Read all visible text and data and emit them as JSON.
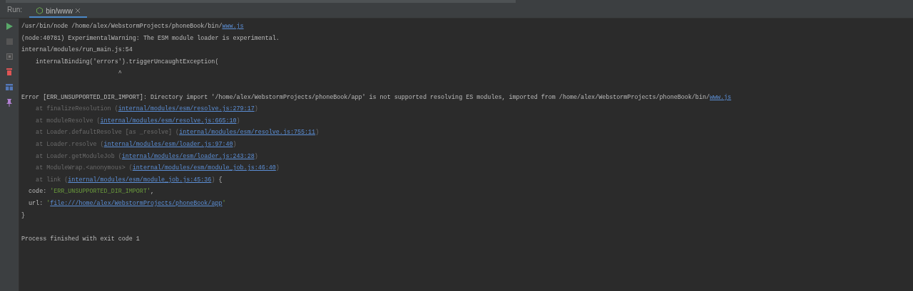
{
  "run_bar": {
    "label": "Run:",
    "tab": {
      "label": "bin/www",
      "selected": true
    }
  },
  "toolbar": [
    {
      "kind": "play"
    },
    {
      "kind": "stop"
    },
    {
      "kind": "restore"
    },
    {
      "kind": "trash"
    },
    {
      "kind": "layout"
    },
    {
      "kind": "pin"
    }
  ],
  "console": {
    "lines": [
      {
        "kind": "text",
        "segments": [
          {
            "kind": "plain",
            "text": "/usr/bin/node /home/alex/WebstormProjects/phoneBook/bin/"
          },
          {
            "kind": "link",
            "text": "www.js"
          }
        ]
      },
      {
        "kind": "text",
        "segments": [
          {
            "kind": "plain",
            "text": "(node:40781) ExperimentalWarning: The ESM module loader is experimental."
          }
        ]
      },
      {
        "kind": "text",
        "segments": [
          {
            "kind": "plain",
            "text": "internal/modules/run_main.js:54"
          }
        ]
      },
      {
        "kind": "text",
        "segments": [
          {
            "kind": "plain",
            "text": "    internalBinding('errors').triggerUncaughtException("
          }
        ]
      },
      {
        "kind": "text",
        "segments": [
          {
            "kind": "plain",
            "text": "                           ^"
          }
        ]
      },
      {
        "kind": "blank"
      },
      {
        "kind": "text",
        "segments": [
          {
            "kind": "plain",
            "text": "Error [ERR_UNSUPPORTED_DIR_IMPORT]: Directory import '/home/alex/WebstormProjects/phoneBook/app' is not supported resolving ES modules, imported from /home/alex/WebstormProjects/phoneBook/bin/"
          },
          {
            "kind": "link",
            "text": "www.js"
          }
        ]
      },
      {
        "kind": "text",
        "segments": [
          {
            "kind": "dim",
            "text": "    at finalizeResolution ("
          },
          {
            "kind": "link",
            "text": "internal/modules/esm/resolve.js:279:17"
          },
          {
            "kind": "dim",
            "text": ")"
          }
        ]
      },
      {
        "kind": "text",
        "segments": [
          {
            "kind": "dim",
            "text": "    at moduleResolve ("
          },
          {
            "kind": "link",
            "text": "internal/modules/esm/resolve.js:665:10"
          },
          {
            "kind": "dim",
            "text": ")"
          }
        ]
      },
      {
        "kind": "text",
        "segments": [
          {
            "kind": "dim",
            "text": "    at Loader.defaultResolve [as _resolve] ("
          },
          {
            "kind": "link",
            "text": "internal/modules/esm/resolve.js:755:11"
          },
          {
            "kind": "dim",
            "text": ")"
          }
        ]
      },
      {
        "kind": "text",
        "segments": [
          {
            "kind": "dim",
            "text": "    at Loader.resolve ("
          },
          {
            "kind": "link",
            "text": "internal/modules/esm/loader.js:97:40"
          },
          {
            "kind": "dim",
            "text": ")"
          }
        ]
      },
      {
        "kind": "text",
        "segments": [
          {
            "kind": "dim",
            "text": "    at Loader.getModuleJob ("
          },
          {
            "kind": "link",
            "text": "internal/modules/esm/loader.js:243:28"
          },
          {
            "kind": "dim",
            "text": ")"
          }
        ]
      },
      {
        "kind": "text",
        "segments": [
          {
            "kind": "dim",
            "text": "    at ModuleWrap.<anonymous> ("
          },
          {
            "kind": "link",
            "text": "internal/modules/esm/module_job.js:46:40"
          },
          {
            "kind": "dim",
            "text": ")"
          }
        ]
      },
      {
        "kind": "text",
        "segments": [
          {
            "kind": "dim",
            "text": "    at link ("
          },
          {
            "kind": "link",
            "text": "internal/modules/esm/module_job.js:45:36"
          },
          {
            "kind": "dim",
            "text": ")"
          },
          {
            "kind": "plain",
            "text": " {"
          }
        ]
      },
      {
        "kind": "text",
        "segments": [
          {
            "kind": "plain",
            "text": "  code: "
          },
          {
            "kind": "string",
            "text": "'ERR_UNSUPPORTED_DIR_IMPORT'"
          },
          {
            "kind": "plain",
            "text": ","
          }
        ]
      },
      {
        "kind": "text",
        "segments": [
          {
            "kind": "plain",
            "text": "  url: "
          },
          {
            "kind": "string",
            "text": "'"
          },
          {
            "kind": "link",
            "text": "file:///home/alex/WebstormProjects/phoneBook/app"
          },
          {
            "kind": "string",
            "text": "'"
          }
        ]
      },
      {
        "kind": "text",
        "segments": [
          {
            "kind": "plain",
            "text": "}"
          }
        ]
      },
      {
        "kind": "blank"
      },
      {
        "kind": "text",
        "segments": [
          {
            "kind": "plain",
            "text": "Process finished with exit code 1"
          }
        ]
      }
    ]
  }
}
